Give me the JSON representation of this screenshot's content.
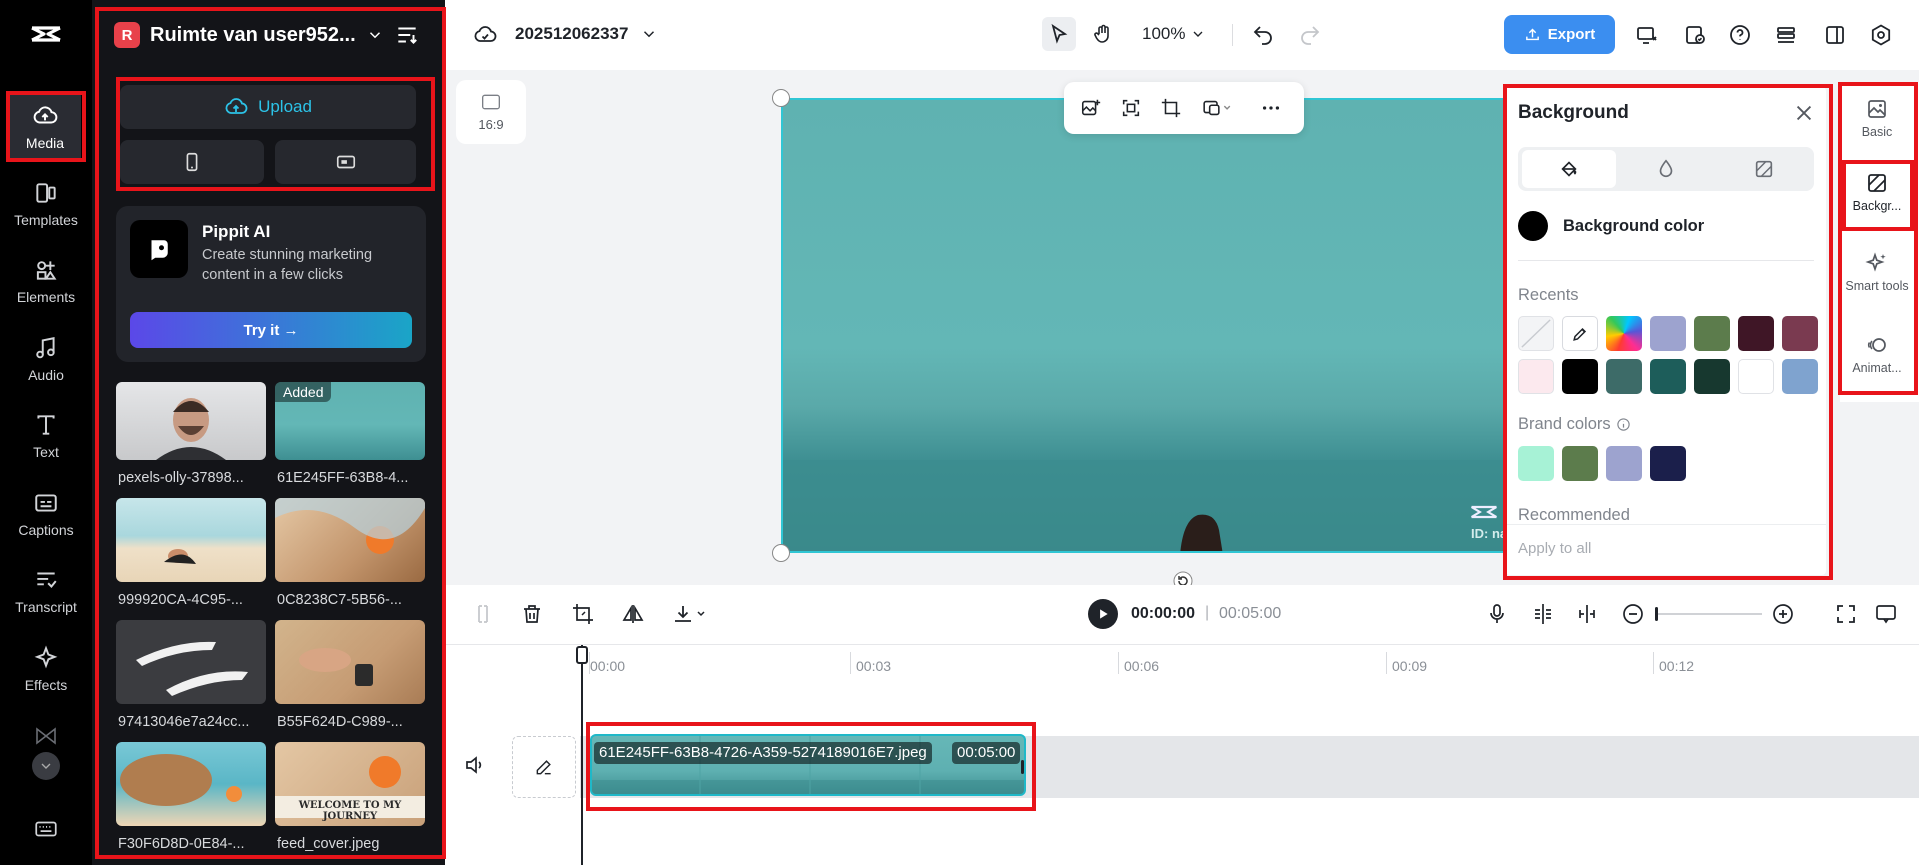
{
  "app": {
    "logo_icon": "capcut-logo-icon"
  },
  "leftnav": {
    "items": [
      {
        "label": "Media",
        "icon": "cloud-upload-icon"
      },
      {
        "label": "Templates",
        "icon": "templates-icon"
      },
      {
        "label": "Elements",
        "icon": "elements-icon"
      },
      {
        "label": "Audio",
        "icon": "music-note-icon"
      },
      {
        "label": "Text",
        "icon": "text-icon"
      },
      {
        "label": "Captions",
        "icon": "captions-icon"
      },
      {
        "label": "Transcript",
        "icon": "transcript-icon"
      },
      {
        "label": "Effects",
        "icon": "sparkle-icon"
      }
    ]
  },
  "mediapanel": {
    "workspace_badge": "R",
    "workspace_name": "Ruimte van user952...",
    "upload_label": "Upload",
    "pippit": {
      "title": "Pippit AI",
      "description": "Create stunning marketing content in a few clicks",
      "cta": "Try it →"
    },
    "thumbs": [
      {
        "label": "pexels-olly-37898...",
        "added": ""
      },
      {
        "label": "61E245FF-63B8-4...",
        "added": "Added"
      },
      {
        "label": "999920CA-4C95-...",
        "added": ""
      },
      {
        "label": "0C8238C7-5B56-...",
        "added": ""
      },
      {
        "label": "97413046e7a24cc...",
        "added": ""
      },
      {
        "label": "B55F624D-C989-...",
        "added": ""
      },
      {
        "label": "F30F6D8D-0E84-...",
        "added": ""
      },
      {
        "label": "feed_cover.jpeg",
        "added": "",
        "overlay": "WELCOME TO MY JOURNEY"
      }
    ]
  },
  "topbar": {
    "project_name": "202512062337",
    "zoom": "100%",
    "export_label": "Export"
  },
  "canvas": {
    "ratio_label": "16:9",
    "watermark_id": "ID: na"
  },
  "bgpanel": {
    "title": "Background",
    "color_label": "Background color",
    "recents_label": "Recents",
    "brand_label": "Brand colors",
    "recommended_label": "Recommended",
    "apply_all": "Apply to all",
    "recents": [
      "none",
      "eyedropper",
      "rainbow",
      "#9da3cf",
      "#5c7c4c",
      "#3f1626",
      "#7a3a50",
      "#fce9ee",
      "#000000",
      "#3d6b68",
      "#1d5d5a",
      "#17382f",
      "#ffffff",
      "#7fa3cf"
    ],
    "brand": [
      "#a7f2d6",
      "#5c7c4c",
      "#9da3cf",
      "#1b1f4b"
    ],
    "selected_color": "#000000"
  },
  "rightstrip": {
    "items": [
      {
        "label": "Basic",
        "icon": "image-basic-icon"
      },
      {
        "label": "Backgr...",
        "icon": "background-icon"
      },
      {
        "label": "Smart tools",
        "icon": "smart-tools-icon"
      },
      {
        "label": "Animat...",
        "icon": "animation-icon"
      }
    ]
  },
  "playback": {
    "current_time": "00:00:00",
    "separator": "|",
    "total_time": "00:05:00"
  },
  "timeline": {
    "ruler": [
      "00:00",
      "00:03",
      "00:06",
      "00:09",
      "00:12"
    ],
    "clip_name": "61E245FF-63B8-4726-A359-5274189016E7.jpeg",
    "clip_duration": "00:05:00"
  }
}
